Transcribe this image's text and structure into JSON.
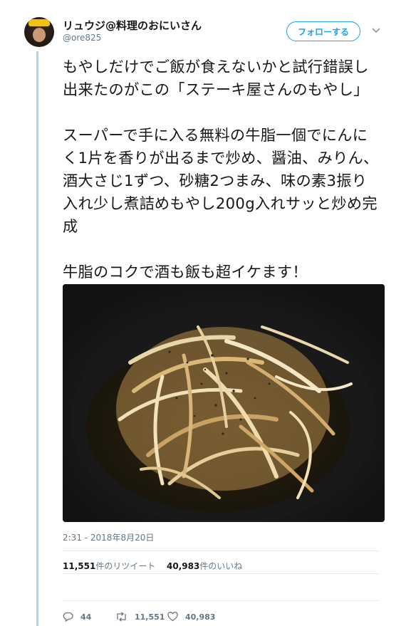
{
  "author": {
    "display_name": "リュウジ@料理のおにいさん",
    "handle": "@ore825"
  },
  "follow_button": {
    "label": "フォローする"
  },
  "menu": {
    "icon": "chevron-down-icon"
  },
  "tweet": {
    "paragraphs": [
      "もやしだけでご飯が食えないかと試行錯誤し出来たのがこの「ステーキ屋さんのもやし」",
      "スーパーで手に入る無料の牛脂一個でにんにく1片を香りが出るまで炒め、醤油、みりん、酒大さじ1ずつ、砂糖2つまみ、味の素3振り入れ少し煮詰めもやし200g入れサッと炒め完成",
      "牛脂のコクで酒も飯も超イケます！"
    ],
    "timestamp": "2:31 - 2018年8月20日"
  },
  "stats": {
    "retweets_count": "11,551",
    "retweets_label": "件のリツイート",
    "likes_count": "40,983",
    "likes_label": "件のいいね"
  },
  "actions": {
    "reply_count": "44",
    "retweet_count": "11,551",
    "like_count": "40,983"
  },
  "colors": {
    "accent": "#1da1f2",
    "thread_line": "#a8d6f2",
    "secondary_text": "#657786"
  }
}
